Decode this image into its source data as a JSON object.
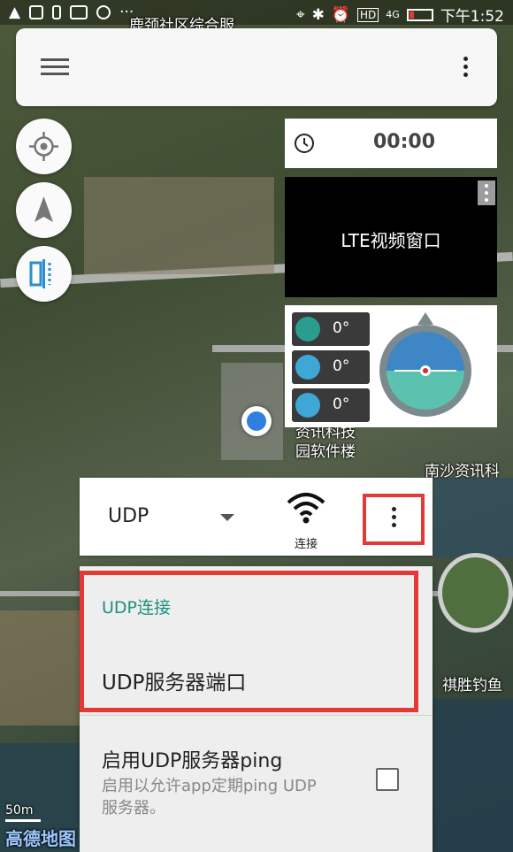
{
  "status_bar": {
    "time": "下午1:52",
    "network": "4G"
  },
  "top_bar": {
    "place_name": "鹿颈社区综合服"
  },
  "timer": {
    "value": "00:00"
  },
  "video": {
    "title": "LTE视频窗口"
  },
  "attitude": {
    "roll": "0°",
    "pitch": "0°",
    "yaw": "0°"
  },
  "map": {
    "scale": "50m",
    "logo": "高德地图",
    "labels": [
      "资讯科技",
      "园软件楼",
      "南沙资讯科",
      "祺胜钓鱼"
    ]
  },
  "udp_bar": {
    "protocol": "UDP",
    "connect_label": "连接"
  },
  "menu": {
    "category": "UDP连接",
    "server_port": "UDP服务器端口",
    "ping_title": "启用UDP服务器ping",
    "ping_desc": "启用以允许app定期ping UDP服务器。",
    "ping_enabled": false
  },
  "colors": {
    "accent": "#1f8f80",
    "highlight": "#e53935"
  }
}
